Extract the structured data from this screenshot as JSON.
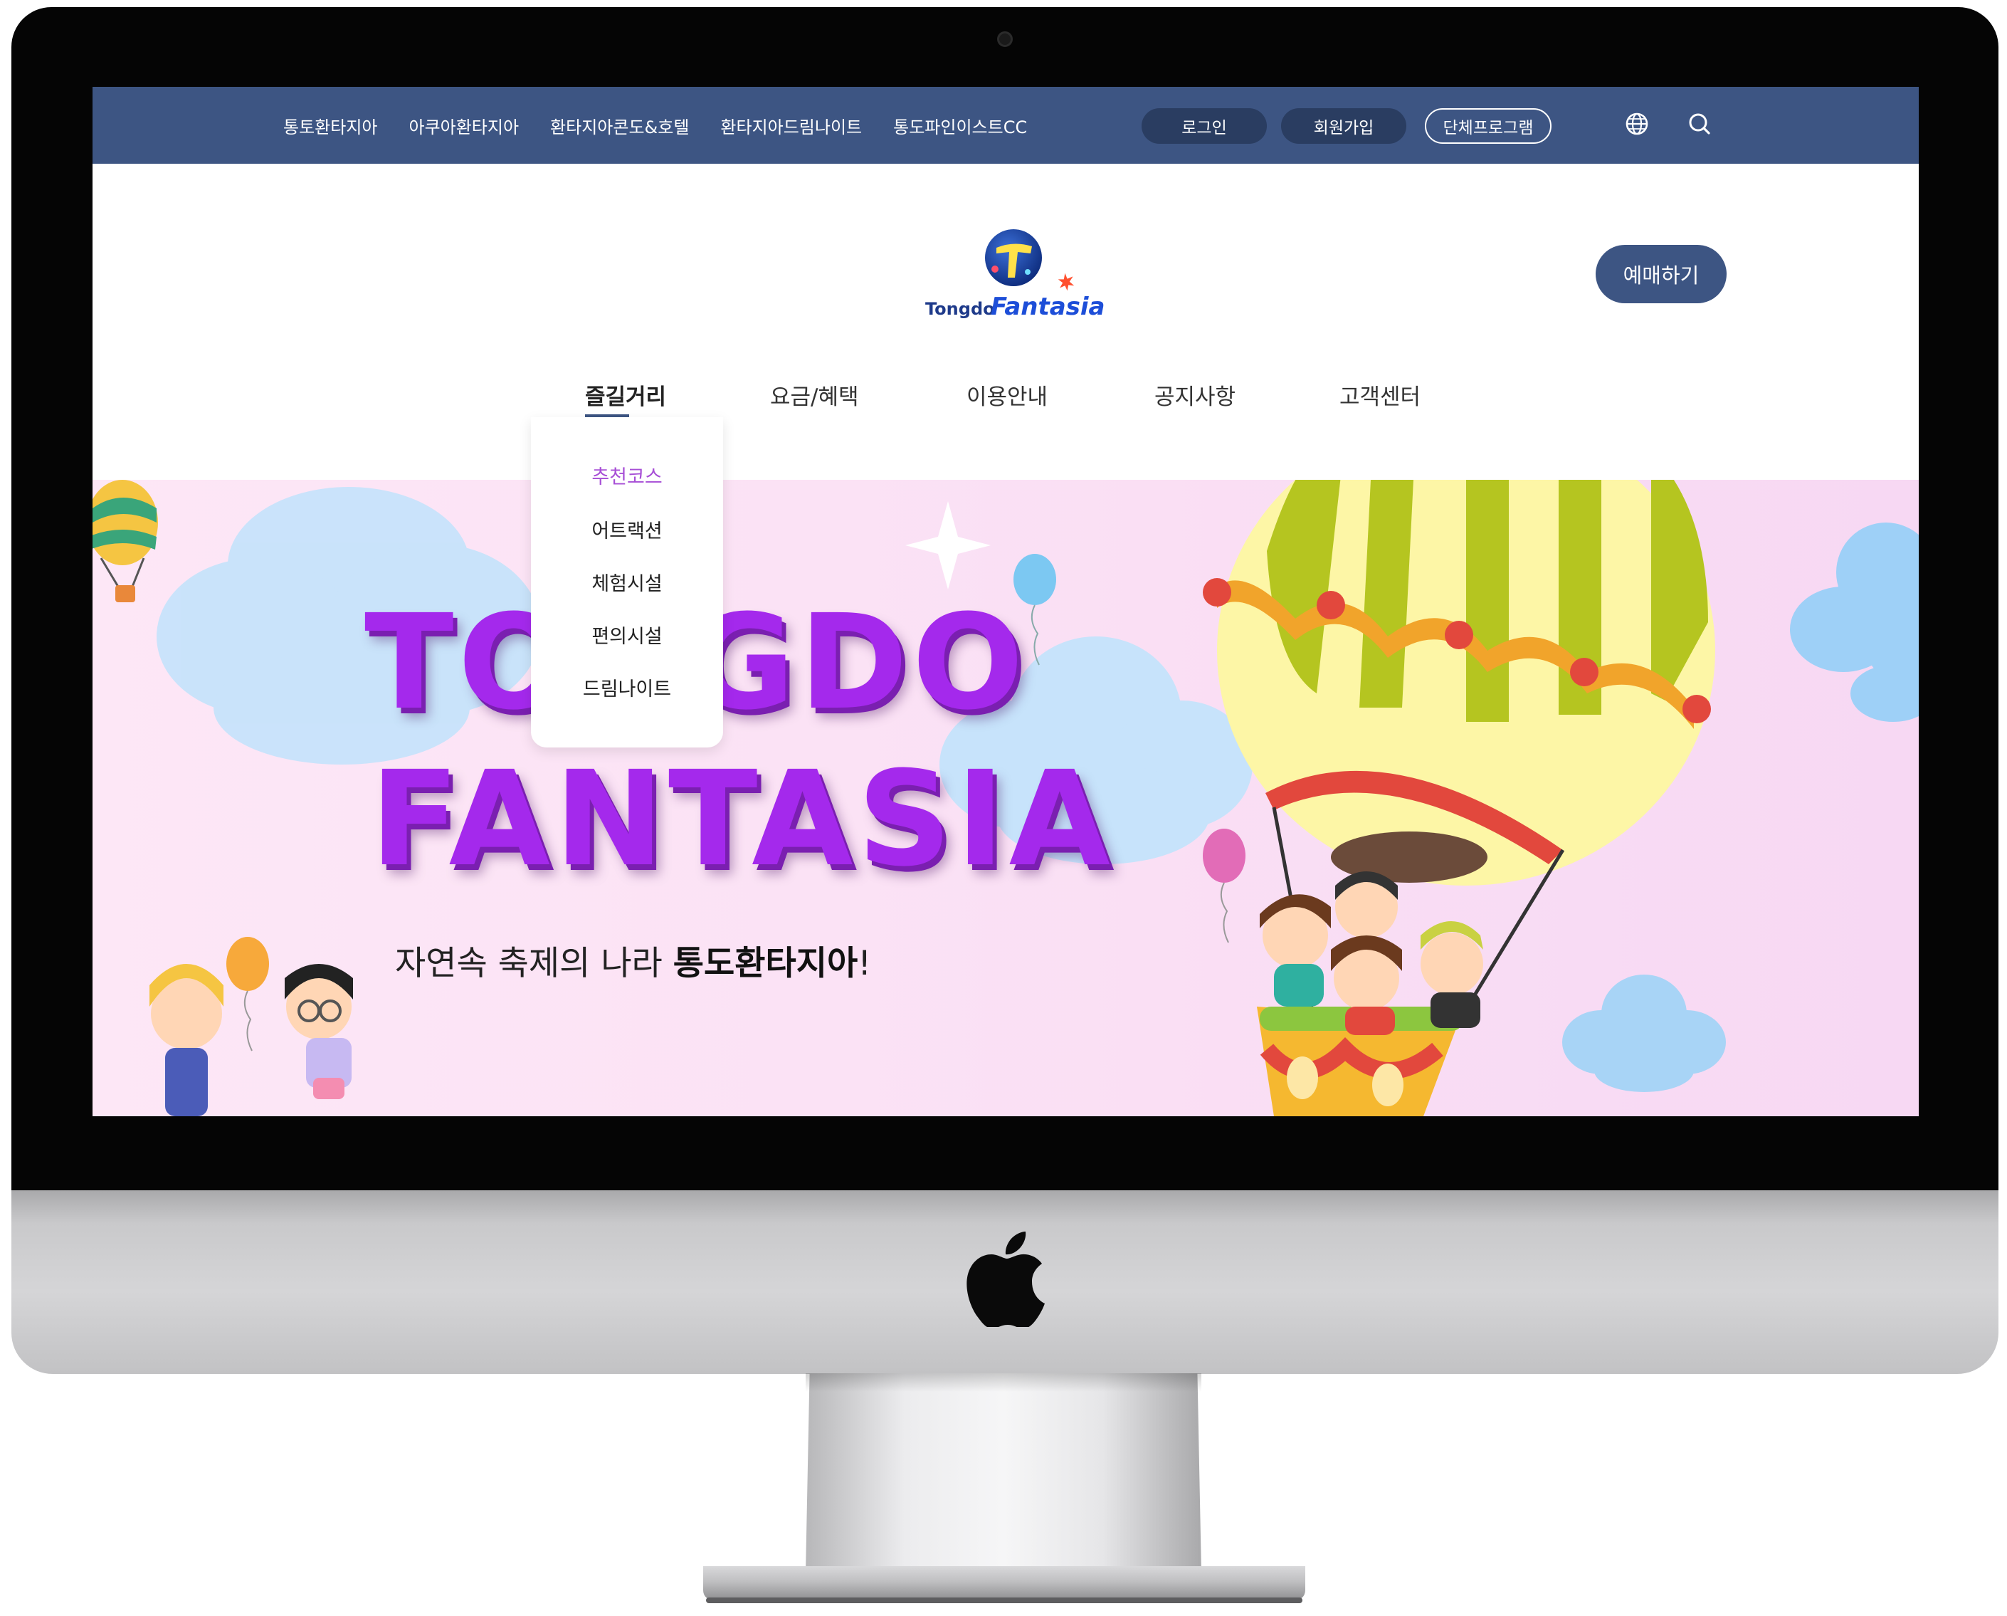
{
  "topbar": {
    "links": [
      "통토환타지아",
      "아쿠아환타지아",
      "환타지아콘도&호텔",
      "환타지아드림나이트",
      "통도파인이스트CC"
    ],
    "login_label": "로그인",
    "signup_label": "회원가입",
    "group_label": "단체프로그램",
    "globe_icon": "globe-icon",
    "search_icon": "search-icon"
  },
  "header": {
    "logo_text_1": "Tongdo",
    "logo_text_2": "Fantasia",
    "book_label": "예매하기"
  },
  "nav": {
    "items": [
      "즐길거리",
      "요금/혜택",
      "이용안내",
      "공지사항",
      "고객센터"
    ],
    "active": "즐길거리"
  },
  "dropdown": {
    "items": [
      "추천코스",
      "어트랙션",
      "체험시설",
      "편의시설",
      "드림나이트"
    ],
    "active": "추천코스"
  },
  "hero": {
    "title_line1": "TONGDO",
    "title_line2": "FANTASIA",
    "slogan_prefix": "자연속 축제의 나라 ",
    "slogan_bold": "통도환타지아",
    "slogan_suffix": "!"
  },
  "colors": {
    "navy": "#3d5583",
    "purple_title": "#a429ec",
    "dropdown_active": "#a74fd6",
    "hero_bg": "#fbe2f5"
  }
}
